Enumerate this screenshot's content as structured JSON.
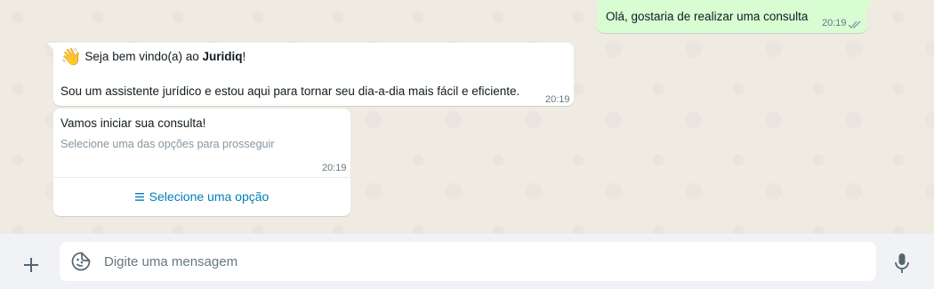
{
  "messages": {
    "out1": {
      "text": "Olá, gostaria de realizar uma consulta",
      "time": "20:19",
      "status_icon": "double-check-icon"
    },
    "in1": {
      "emoji": "👋",
      "line1_before": " Seja bem vindo(a) ao ",
      "line1_bold": "Juridiq",
      "line1_after": "!",
      "line2": "Sou um assistente jurídico e estou aqui para tornar seu dia-a-dia mais fácil e eficiente.",
      "time": "20:19"
    },
    "in2": {
      "title": "Vamos iniciar sua consulta!",
      "subtitle": "Selecione uma das opções para prosseguir",
      "time": "20:19",
      "button_icon": "list-icon",
      "button_label": "Selecione uma opção"
    }
  },
  "composer": {
    "placeholder": "Digite uma mensagem",
    "value": "",
    "left_icon": "plus-icon",
    "emoji_icon": "sticker-icon",
    "right_icon": "microphone-icon"
  },
  "colors": {
    "outgoing_bubble": "#d9fdd3",
    "incoming_bubble": "#ffffff",
    "chat_background": "#efeae2",
    "footer_background": "#f0f2f5",
    "link_blue": "#027eb5",
    "read_tick": "#8696a0"
  }
}
